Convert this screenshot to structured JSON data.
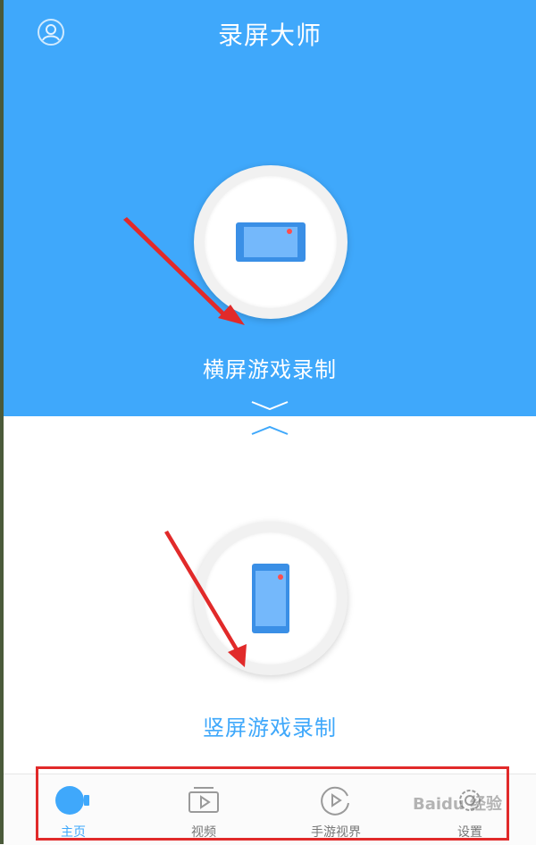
{
  "header": {
    "title": "录屏大师"
  },
  "modes": {
    "landscape_label": "横屏游戏录制",
    "portrait_label": "竖屏游戏录制"
  },
  "tabs": [
    {
      "label": "主页",
      "icon": "home-camera-icon",
      "active": true
    },
    {
      "label": "视频",
      "icon": "video-icon",
      "active": false
    },
    {
      "label": "手游视界",
      "icon": "game-view-icon",
      "active": false
    },
    {
      "label": "设置",
      "icon": "gear-icon",
      "active": false
    }
  ],
  "watermark": "Baidu 经验",
  "colors": {
    "accent": "#3fa8fb",
    "annotation": "#e12a2a",
    "phone_icon": "#3a8fe6",
    "record_dot": "#ff4d4d"
  }
}
